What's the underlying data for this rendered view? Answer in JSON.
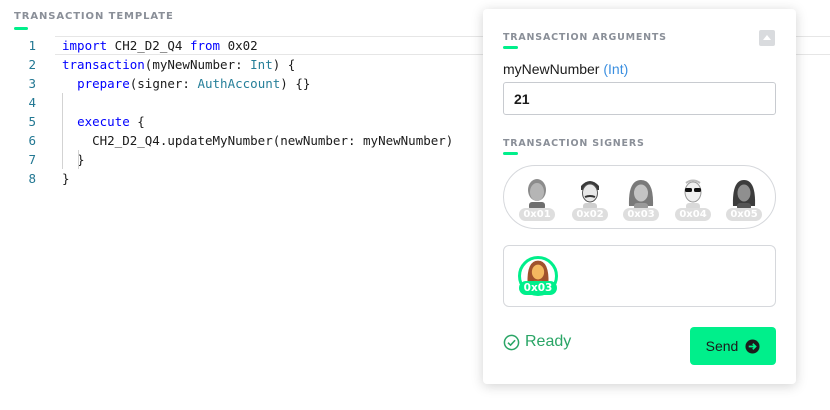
{
  "editor": {
    "section_title": "TRANSACTION TEMPLATE",
    "lines": [
      {
        "num": "1",
        "tokens": [
          [
            "kw",
            "import"
          ],
          [
            "",
            " CH2_D2_Q4 "
          ],
          [
            "kw",
            "from"
          ],
          [
            "",
            " 0x02"
          ]
        ]
      },
      {
        "num": "2",
        "tokens": [
          [
            "kw",
            "transaction"
          ],
          [
            "",
            "(myNewNumber: "
          ],
          [
            "ty",
            "Int"
          ],
          [
            "",
            ") {"
          ]
        ]
      },
      {
        "num": "3",
        "tokens": [
          [
            "",
            "  "
          ],
          [
            "kw",
            "prepare"
          ],
          [
            "",
            "(signer: "
          ],
          [
            "ty",
            "AuthAccount"
          ],
          [
            "",
            ") {}"
          ]
        ]
      },
      {
        "num": "4",
        "tokens": []
      },
      {
        "num": "5",
        "tokens": [
          [
            "",
            "  "
          ],
          [
            "kw",
            "execute"
          ],
          [
            "",
            " {"
          ]
        ]
      },
      {
        "num": "6",
        "tokens": [
          [
            "",
            "    CH2_D2_Q4.updateMyNumber(newNumber: myNewNumber)"
          ]
        ]
      },
      {
        "num": "7",
        "tokens": [
          [
            "",
            "  }"
          ]
        ]
      },
      {
        "num": "8",
        "tokens": [
          [
            "",
            "}"
          ]
        ]
      }
    ]
  },
  "panel": {
    "arguments_title": "TRANSACTION ARGUMENTS",
    "arg_name": "myNewNumber",
    "arg_type": "(Int)",
    "arg_value": "21",
    "signers_title": "TRANSACTION SIGNERS",
    "signers": [
      {
        "address": "0x01",
        "icon": "avatar-man-short-hair"
      },
      {
        "address": "0x02",
        "icon": "avatar-man-mustache"
      },
      {
        "address": "0x03",
        "icon": "avatar-woman-long-hair"
      },
      {
        "address": "0x04",
        "icon": "avatar-sunglasses"
      },
      {
        "address": "0x05",
        "icon": "avatar-woman-dark-hair"
      }
    ],
    "selected_signer": {
      "address": "0x03",
      "icon": "avatar-woman-long-hair"
    },
    "status": "Ready",
    "send_label": "Send"
  },
  "colors": {
    "accent": "#00ef8b",
    "ready": "#2aa566",
    "keyword": "#0000ff",
    "type": "#267f99",
    "arg_type": "#3b8fe0"
  }
}
